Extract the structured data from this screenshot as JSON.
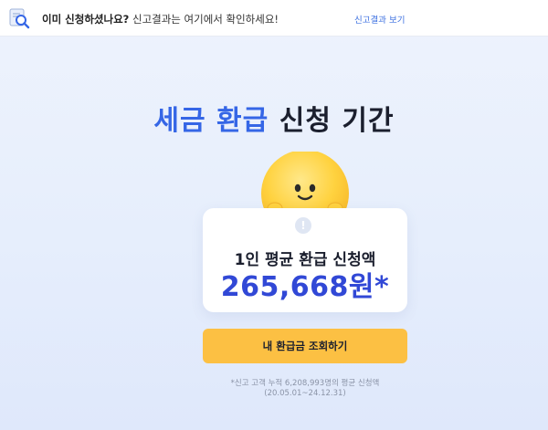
{
  "topbar": {
    "question": "이미 신청하셨나요?",
    "message": "신고결과는 여기에서 확인하세요!",
    "link_label": "신고결과 보기"
  },
  "main": {
    "title_highlight": "세금 환급",
    "title_rest": "신청 기간",
    "card_label": "1인 평균 환급 신청액",
    "card_amount": "265,668원*",
    "cta_label": "내 환급금 조회하기",
    "footnote_line1": "*신고 고객 누적 6,208,993명의 평균 신청액",
    "footnote_line2": "(20.05.01~24.12.31)"
  },
  "colors": {
    "accent_blue": "#3566e6",
    "amount_blue": "#3148d6",
    "cta_yellow": "#fcc043",
    "mascot_yellow": "#ffd23f"
  },
  "icons": {
    "topbar": "document-search-icon",
    "alert": "exclamation-circle-icon",
    "mascot": "smiling-sun-mascot-icon"
  }
}
